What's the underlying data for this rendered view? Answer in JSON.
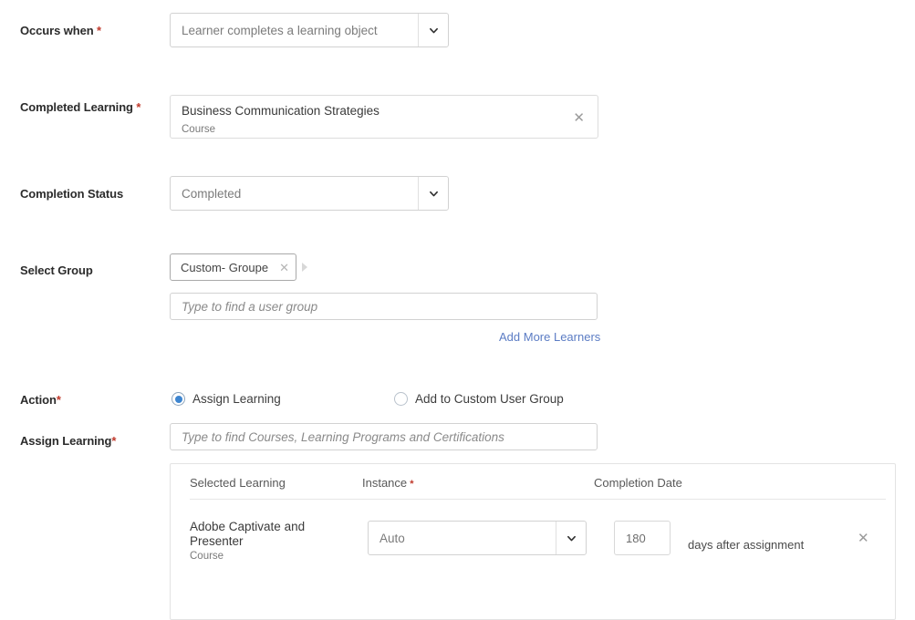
{
  "form": {
    "fields": [
      {
        "label": "Occurs when",
        "required": true,
        "required_spaced": true,
        "control": "select",
        "value": "Learner completes a learning object"
      },
      {
        "label": "Completed Learning",
        "required": true,
        "required_spaced": true,
        "control": "card",
        "title": "Business Communication Strategies",
        "subtitle": "Course",
        "remove_icon": "close-icon"
      },
      {
        "label": "Completion Status",
        "required": false,
        "control": "select",
        "value": "Completed"
      },
      {
        "label": "Select Group",
        "required": false,
        "control": "group-picker",
        "chip": "Custom- Groupe",
        "chip_remove_icon": "close-icon",
        "placeholder": "Type to find a user group",
        "link": "Add More Learners"
      },
      {
        "label": "Action",
        "required": true,
        "required_spaced": false,
        "control": "radio-group"
      },
      {
        "label": "Assign Learning",
        "required": true,
        "required_spaced": false,
        "control": "search-input",
        "placeholder": "Type to find Courses, Learning Programs and Certifications"
      }
    ],
    "action_options": [
      {
        "label": "Assign Learning",
        "selected": true
      },
      {
        "label": "Add to Custom User Group",
        "selected": false
      }
    ]
  },
  "table": {
    "headers": [
      {
        "text": "Selected Learning",
        "required": false
      },
      {
        "text": "Instance",
        "required": true
      },
      {
        "text": "Completion Date",
        "required": false
      }
    ],
    "rows": [
      {
        "title": "Adobe Captivate and Presenter",
        "subtitle": "Course",
        "instance": "Auto",
        "days": "180",
        "days_suffix": "days after assignment",
        "remove_icon": "close-icon"
      }
    ]
  },
  "icons": {
    "chevron_down": "chevron-down-icon",
    "close": "close-icon",
    "caret_right": "caret-right-icon"
  },
  "colors": {
    "required_asterisk": "#c0392b",
    "link": "#5b7cc4",
    "radio_selected": "#3d85d0",
    "border": "#d2d2d2",
    "label_text": "#2b2b2b",
    "placeholder_text": "#8a8a8a"
  }
}
